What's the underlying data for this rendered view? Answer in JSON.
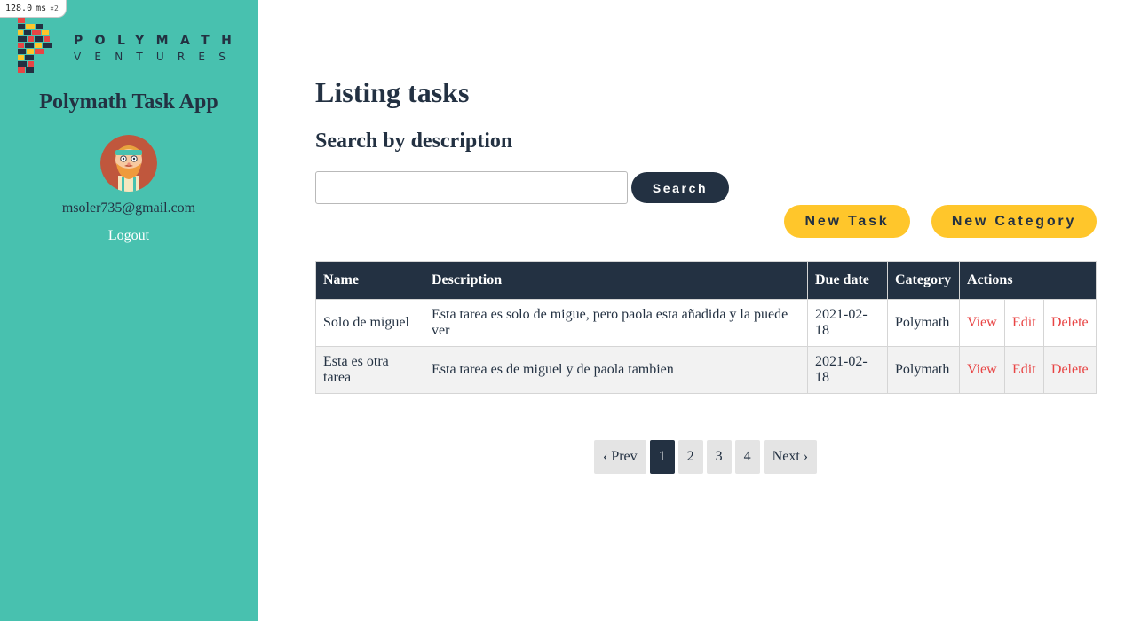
{
  "perf": {
    "value": "128.0",
    "unit": "ms",
    "multiplier": "×2"
  },
  "sidebar": {
    "logo": {
      "line1": "POLYMATH",
      "line2": "VENTURES"
    },
    "app_title": "Polymath Task App",
    "user_email": "msoler735@gmail.com",
    "logout_label": "Logout"
  },
  "main": {
    "title": "Listing tasks",
    "search_heading": "Search by description",
    "search": {
      "value": "",
      "placeholder": "",
      "button_label": "Search"
    },
    "new_task_label": "New Task",
    "new_category_label": "New Category",
    "table": {
      "headers": [
        "Name",
        "Description",
        "Due date",
        "Category",
        "Actions"
      ],
      "rows": [
        {
          "name": "Solo de miguel",
          "description": "Esta tarea es solo de migue, pero paola esta añadida y la puede ver",
          "due_date": "2021-02-18",
          "category": "Polymath",
          "view": "View",
          "edit": "Edit",
          "delete": "Delete"
        },
        {
          "name": "Esta es otra tarea",
          "description": "Esta tarea es de miguel y de paola tambien",
          "due_date": "2021-02-18",
          "category": "Polymath",
          "view": "View",
          "edit": "Edit",
          "delete": "Delete"
        }
      ]
    },
    "pagination": {
      "prev": "‹ Prev",
      "pages": [
        "1",
        "2",
        "3",
        "4"
      ],
      "current": "1",
      "next": "Next ›"
    }
  },
  "colors": {
    "sidebar_bg": "#48c1af",
    "primary_dark": "#233142",
    "accent_yellow": "#ffc62b",
    "link_red": "#e84545"
  }
}
